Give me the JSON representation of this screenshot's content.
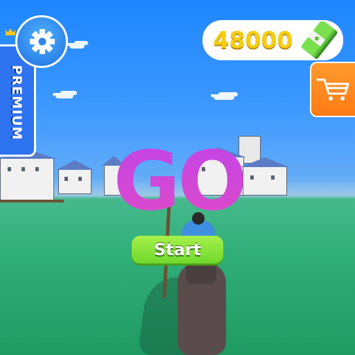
{
  "hud": {
    "currency": {
      "amount": "48000",
      "icon": "cash-stack-icon"
    },
    "settings": {
      "icon": "gear-icon"
    },
    "premium": {
      "label": "PREMIUM",
      "icon": "crown-icon"
    },
    "shop": {
      "icon": "shopping-cart-icon"
    }
  },
  "center": {
    "go_text": "GO",
    "start_label": "Start"
  },
  "colors": {
    "sky": "#2f8fff",
    "grass": "#2fb07a",
    "go_text": "#d047d8",
    "start_button": "#8be33a",
    "premium_tab": "#2e73f0",
    "shop_button": "#ff8a20",
    "currency_text": "#f7cd12"
  }
}
